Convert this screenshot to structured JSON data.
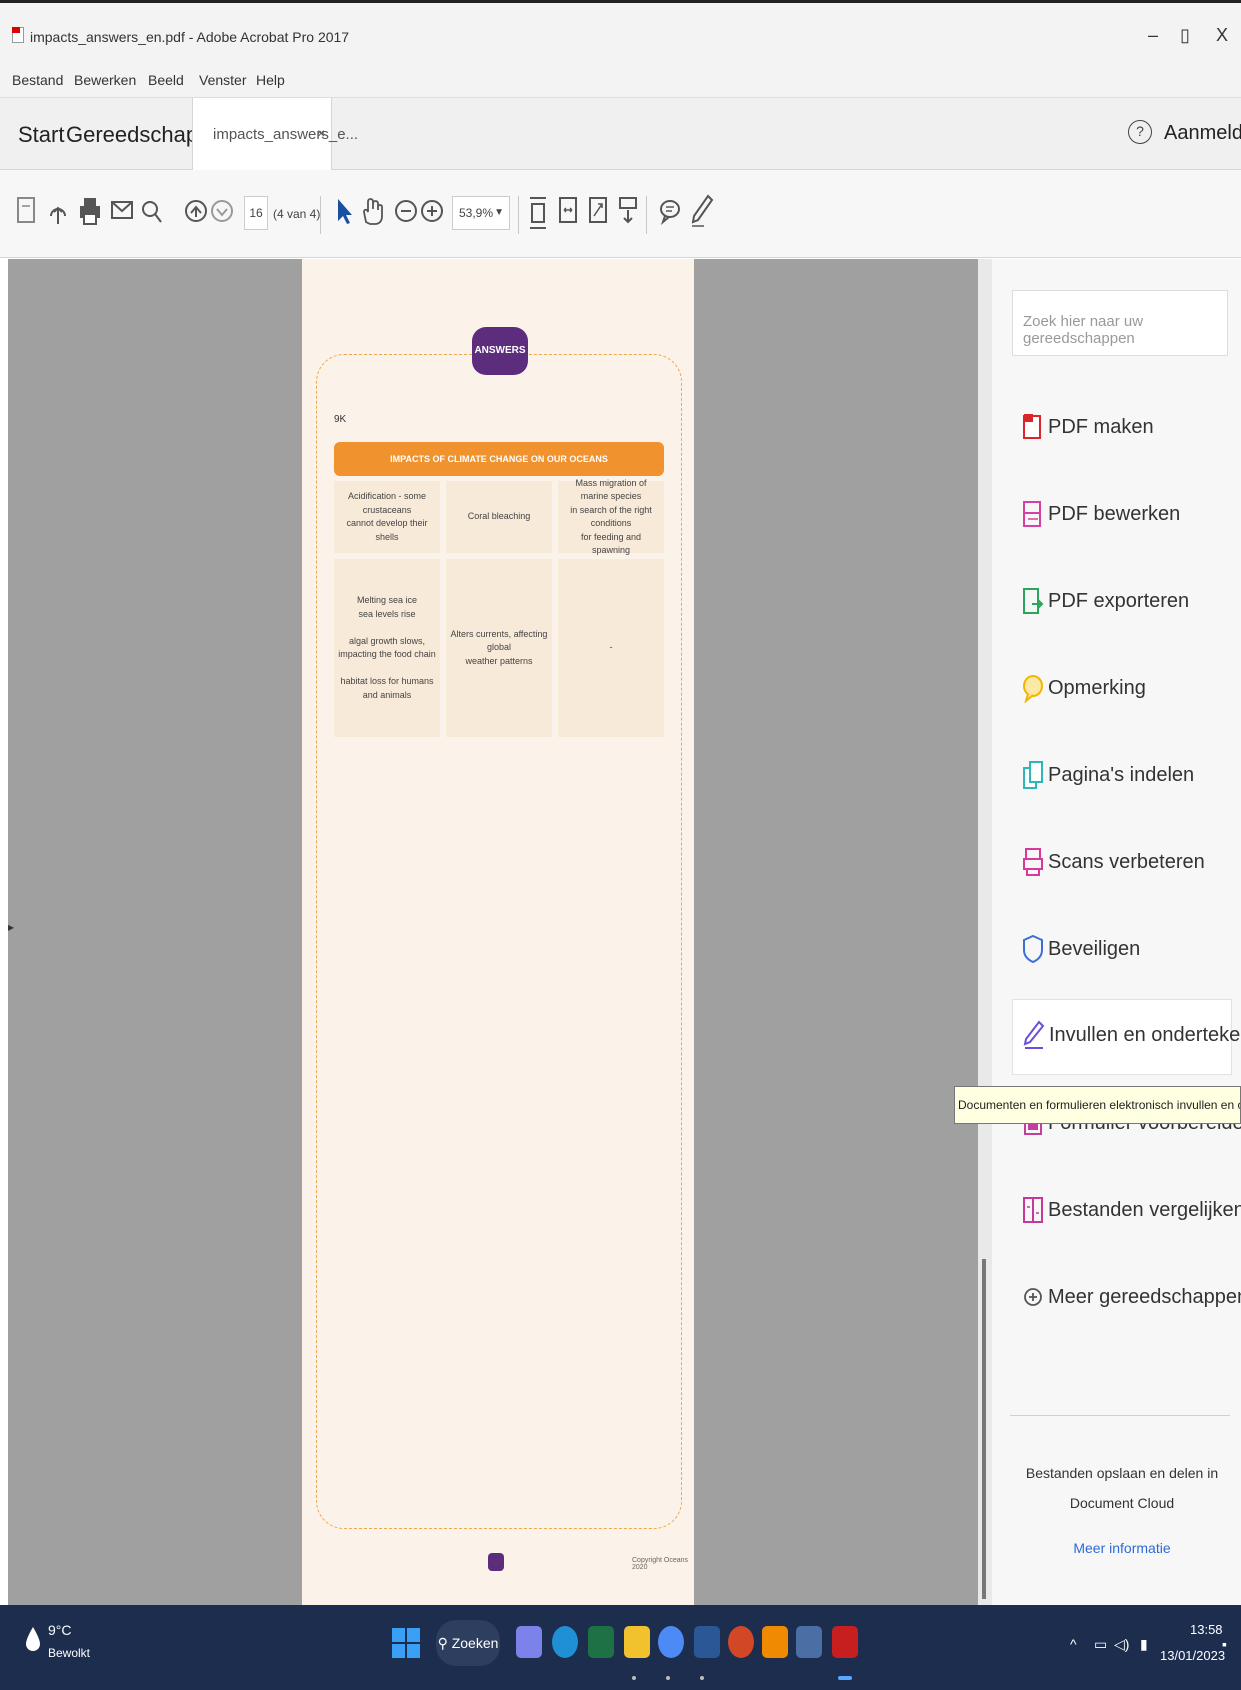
{
  "window": {
    "title": "impacts_answers_en.pdf - Adobe Acrobat Pro 2017",
    "controls": {
      "minimize": "–",
      "restore": "▯",
      "close": "X"
    }
  },
  "menu": [
    "Bestand",
    "Bewerken",
    "Beeld",
    "Venster",
    "Help"
  ],
  "tabs": {
    "start": "Start",
    "tools": "Gereedschappen",
    "document": "impacts_answers_e...",
    "close": "×",
    "help": "?",
    "signin": "Aanmelden"
  },
  "toolbar": {
    "page_current": "16",
    "page_of": "(4 van 4)",
    "zoom": "53,9%",
    "icons": [
      "create-pdf-icon",
      "upload-icon",
      "print-icon",
      "email-icon",
      "find-icon",
      "page-up-icon",
      "page-down-icon",
      "select-arrow-icon",
      "hand-tool-icon",
      "zoom-out-icon",
      "zoom-in-icon",
      "fit-page-icon",
      "fit-width-icon",
      "full-screen-icon",
      "scroll-mode-icon",
      "comment-icon",
      "sign-pen-icon"
    ]
  },
  "document": {
    "badge": "ANSWERS",
    "question_number": "9K",
    "table_header": "IMPACTS OF CLIMATE CHANGE ON OUR OCEANS",
    "row1": [
      "Acidification - some crustaceans\ncannot develop their shells",
      "Coral bleaching",
      "Mass migration of marine species\nin search of the right conditions\nfor feeding and spawning"
    ],
    "row2": [
      "Melting sea ice\nsea levels rise\n\nalgal growth slows,\nimpacting the food chain\n\nhabitat loss for humans\nand animals",
      "Alters currents, affecting global\nweather patterns",
      "-"
    ],
    "copyright": "Copyright Oceans 2020"
  },
  "tools_pane": {
    "search_placeholder": "Zoek hier naar uw gereedschappen",
    "items": [
      {
        "label": "PDF maken",
        "icon": "pdf-create-icon",
        "color": "#d9262c"
      },
      {
        "label": "PDF bewerken",
        "icon": "pdf-edit-icon",
        "color": "#d63fa3"
      },
      {
        "label": "PDF exporteren",
        "icon": "pdf-export-icon",
        "color": "#2aa55a"
      },
      {
        "label": "Opmerking",
        "icon": "comment-icon",
        "color": "#f4b400"
      },
      {
        "label": "Pagina's indelen",
        "icon": "organize-pages-icon",
        "color": "#2bb8b8"
      },
      {
        "label": "Scans verbeteren",
        "icon": "enhance-scans-icon",
        "color": "#d6399a"
      },
      {
        "label": "Beveiligen",
        "icon": "shield-icon",
        "color": "#3a6fd8"
      },
      {
        "label": "Invullen en ondertekenen",
        "icon": "fill-sign-icon",
        "color": "#6c4ed8"
      },
      {
        "label": "Formulier voorbereiden",
        "icon": "prepare-form-icon",
        "color": "#c03fa0"
      },
      {
        "label": "Bestanden vergelijken",
        "icon": "compare-files-icon",
        "color": "#c8389b"
      },
      {
        "label": "Meer gereedschappen",
        "icon": "more-tools-icon",
        "color": "#555555"
      }
    ],
    "tooltip": "Documenten en formulieren elektronisch invullen en ondertekenen",
    "cloud_text": "Bestanden opslaan en delen in Document Cloud",
    "more_info": "Meer informatie"
  },
  "taskbar": {
    "weather_temp": "9°C",
    "weather_desc": "Bewolkt",
    "search": "Zoeken",
    "tray": "^",
    "time": "13:58",
    "date": "13/01/2023"
  },
  "colors": {
    "acrobat_red": "#d00000",
    "answers_purple": "#5c2d7c",
    "table_orange": "#f0922d",
    "taskbar": "#1c2d4e",
    "link_blue": "#2d6ad8"
  }
}
